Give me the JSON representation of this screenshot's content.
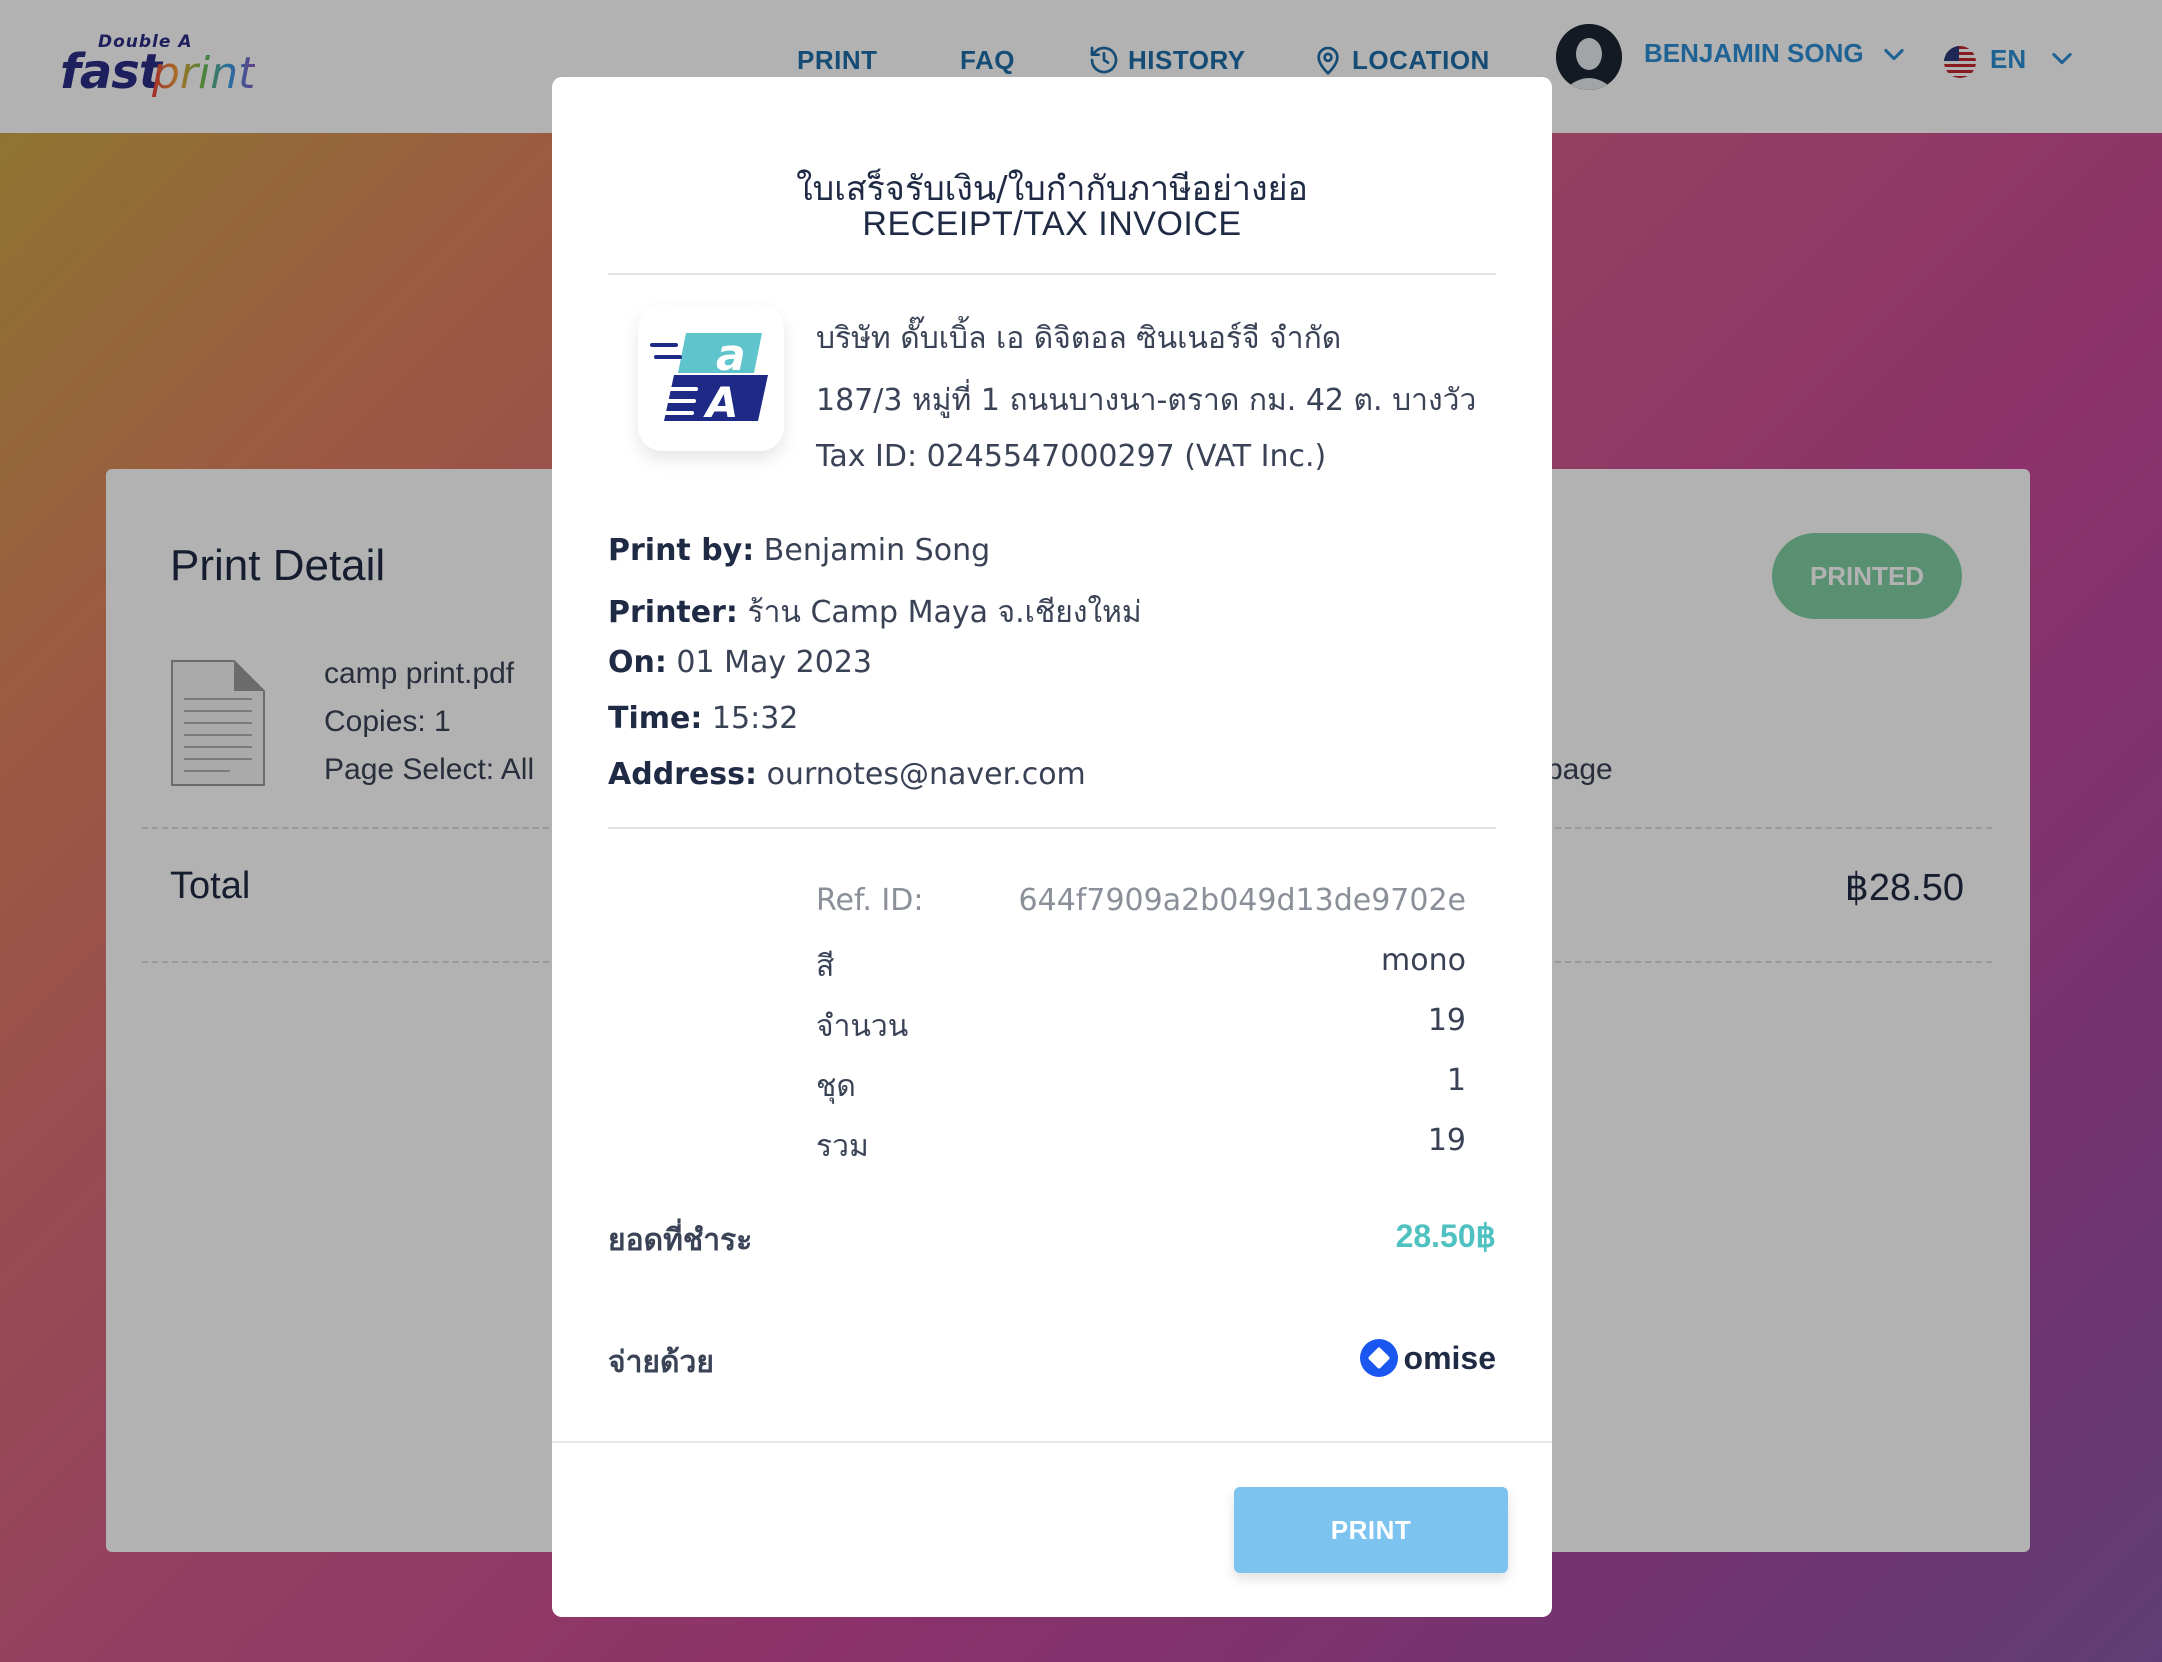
{
  "brand": {
    "small": "Double A",
    "fast": "fast",
    "print": "print"
  },
  "nav": {
    "print": "PRINT",
    "faq": "FAQ",
    "history": "HISTORY",
    "location": "LOCATION",
    "user": "BENJAMIN SONG",
    "lang": "EN"
  },
  "card": {
    "title": "Print Detail",
    "status": "PRINTED",
    "file_name": "camp print.pdf",
    "copies": "Copies: 1",
    "page_select": "Page Select: All",
    "page_info": "page",
    "total_label": "Total",
    "total_value": "฿28.50"
  },
  "modal": {
    "title_th": "ใบเสร็จรับเงิน/ใบกำกับภาษีอย่างย่อ",
    "title_en": "RECEIPT/TAX INVOICE",
    "company": {
      "name": "บริษัท ดั๊บเบิ้ล เอ ดิจิตอล ซินเนอร์จี จำกัด",
      "address": "187/3 หมู่ที่ 1 ถนนบางนา-ตราด กม. 42 ต. บางวัว",
      "tax_id": "Tax ID: 0245547000297 (VAT Inc.)"
    },
    "info": {
      "print_by_label": "Print by:",
      "print_by": "Benjamin Song",
      "printer_label": "Printer:",
      "printer": "ร้าน Camp Maya จ.เชียงใหม่",
      "on_label": "On:",
      "on": "01 May 2023",
      "time_label": "Time:",
      "time": "15:32",
      "address_label": "Address:",
      "address": "ournotes@naver.com"
    },
    "details": {
      "ref_label": "Ref. ID:",
      "ref_value": "644f7909a2b049d13de9702e",
      "color_label": "สี",
      "color_value": "mono",
      "qty_label": "จำนวน",
      "qty_value": "19",
      "set_label": "ชุด",
      "set_value": "1",
      "sum_label": "รวม",
      "sum_value": "19"
    },
    "payment": {
      "amount_label": "ยอดที่ชำระ",
      "amount_value": "28.50฿",
      "method_label": "จ่ายด้วย",
      "method_value": "omise"
    },
    "print_button": "PRINT"
  }
}
